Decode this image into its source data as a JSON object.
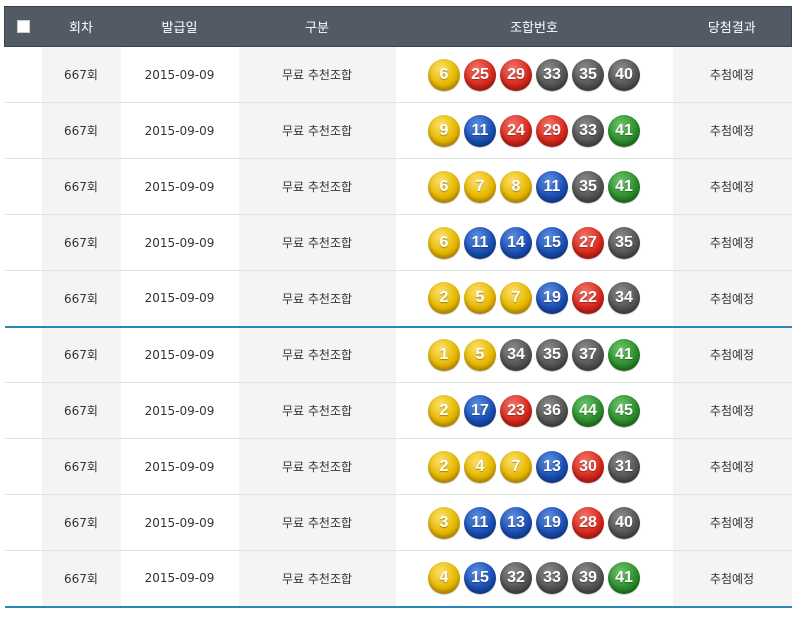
{
  "header": {
    "round": "회차",
    "issue_date": "발급일",
    "category": "구분",
    "combination": "조합번호",
    "result": "당첨결과"
  },
  "colors": {
    "yellow": "#e7b800",
    "blue": "#1a4fb4",
    "red": "#d8281c",
    "gray": "#555555",
    "green": "#2c8e2c",
    "header_bg": "#525a66",
    "group_divider": "#2a86b5"
  },
  "rows": [
    {
      "round": "667회",
      "date": "2015-09-09",
      "type": "무료 추천조합",
      "numbers": [
        6,
        25,
        29,
        33,
        35,
        40
      ],
      "result": "추첨예정"
    },
    {
      "round": "667회",
      "date": "2015-09-09",
      "type": "무료 추천조합",
      "numbers": [
        9,
        11,
        24,
        29,
        33,
        41
      ],
      "result": "추첨예정"
    },
    {
      "round": "667회",
      "date": "2015-09-09",
      "type": "무료 추천조합",
      "numbers": [
        6,
        7,
        8,
        11,
        35,
        41
      ],
      "result": "추첨예정"
    },
    {
      "round": "667회",
      "date": "2015-09-09",
      "type": "무료 추천조합",
      "numbers": [
        6,
        11,
        14,
        15,
        27,
        35
      ],
      "result": "추첨예정"
    },
    {
      "round": "667회",
      "date": "2015-09-09",
      "type": "무료 추천조합",
      "numbers": [
        2,
        5,
        7,
        19,
        22,
        34
      ],
      "result": "추첨예정"
    },
    {
      "round": "667회",
      "date": "2015-09-09",
      "type": "무료 추천조합",
      "numbers": [
        1,
        5,
        34,
        35,
        37,
        41
      ],
      "result": "추첨예정"
    },
    {
      "round": "667회",
      "date": "2015-09-09",
      "type": "무료 추천조합",
      "numbers": [
        2,
        17,
        23,
        36,
        44,
        45
      ],
      "result": "추첨예정"
    },
    {
      "round": "667회",
      "date": "2015-09-09",
      "type": "무료 추천조합",
      "numbers": [
        2,
        4,
        7,
        13,
        30,
        31
      ],
      "result": "추첨예정"
    },
    {
      "round": "667회",
      "date": "2015-09-09",
      "type": "무료 추천조합",
      "numbers": [
        3,
        11,
        13,
        19,
        28,
        40
      ],
      "result": "추첨예정"
    },
    {
      "round": "667회",
      "date": "2015-09-09",
      "type": "무료 추천조합",
      "numbers": [
        4,
        15,
        32,
        33,
        39,
        41
      ],
      "result": "추첨예정"
    }
  ]
}
